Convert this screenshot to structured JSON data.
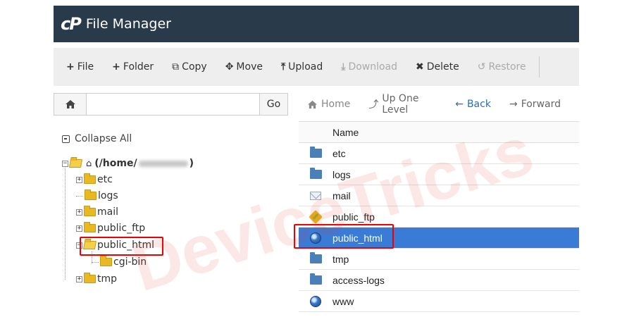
{
  "app": {
    "logo": "cP",
    "title": "File Manager"
  },
  "toolbar": {
    "file": "File",
    "folder": "Folder",
    "copy": "Copy",
    "move": "Move",
    "upload": "Upload",
    "download": "Download",
    "delete": "Delete",
    "restore": "Restore"
  },
  "search": {
    "value": "",
    "go": "Go"
  },
  "nav": {
    "home": "Home",
    "up": "Up One Level",
    "back": "Back",
    "forward": "Forward"
  },
  "tree": {
    "collapse_all": "Collapse All",
    "root": "(/home/",
    "root_suffix": ")",
    "items": [
      "etc",
      "logs",
      "mail",
      "public_ftp",
      "public_html",
      "cgi-bin",
      "tmp"
    ]
  },
  "filelist": {
    "header": "Name",
    "rows": [
      {
        "name": "etc",
        "icon": "folder-icon"
      },
      {
        "name": "logs",
        "icon": "folder-icon"
      },
      {
        "name": "mail",
        "icon": "mail-icon"
      },
      {
        "name": "public_ftp",
        "icon": "ftp-icon"
      },
      {
        "name": "public_html",
        "icon": "globe-icon",
        "selected": true
      },
      {
        "name": "tmp",
        "icon": "folder-icon"
      },
      {
        "name": "access-logs",
        "icon": "folder-icon"
      },
      {
        "name": "www",
        "icon": "globe-icon"
      }
    ]
  },
  "watermark": "DeviceTricks",
  "colors": {
    "titlebar": "#293a4a",
    "selected_row": "#3a7bd5",
    "highlight": "#e00000"
  }
}
